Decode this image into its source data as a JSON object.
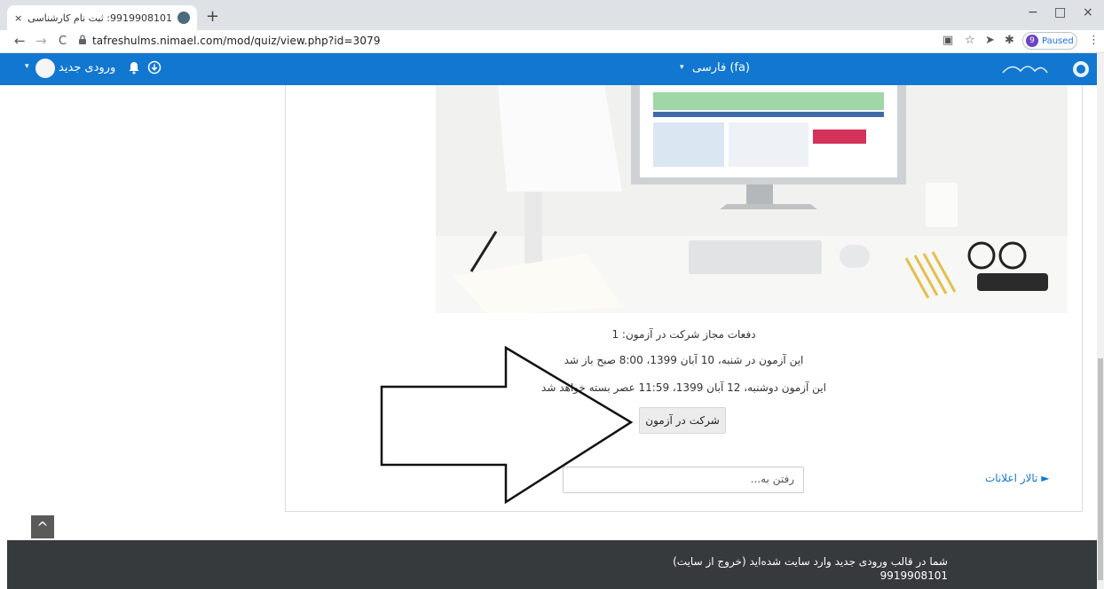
{
  "browser": {
    "tab_title": "9919908101: ثبت نام کارشناسی ار...",
    "tab_close": "×",
    "new_tab": "+",
    "window_controls": [
      "−",
      "□",
      "×"
    ],
    "nav_back": "←",
    "nav_forward": "→",
    "nav_reload": "C",
    "url": "tafreshulms.nimael.com/mod/quiz/view.php?id=3079",
    "paused_count": "9",
    "paused_label": "Paused",
    "menu": "⋮"
  },
  "navbar": {
    "username": "ورودی جدید",
    "language": "فارسی (fa)",
    "language_caret": "▾",
    "user_caret": "▾"
  },
  "quiz": {
    "attempts_allowed": "دفعات مجاز شرکت در آزمون: 1",
    "opened": "این آزمون در شنبه، 10 آبان 1399، 8:00 صبح باز شد",
    "closes": "این آزمون دوشنبه، 12 آبان 1399، 11:59 عصر بسته خواهد شد",
    "attempt_button": "شرکت در آزمون"
  },
  "navigation": {
    "jump_placeholder": "رفتن به...",
    "prev_activity": "► تالار اعلانات"
  },
  "back_to_top": "^",
  "footer": {
    "logged_in": "شما در قالب ورودی جدید وارد سایت شده‌اید (خروج از سایت)",
    "user_id": "9919908101"
  },
  "colors": {
    "navbar": "#1177d1",
    "footer": "#373a3c",
    "link": "#1177d1"
  }
}
